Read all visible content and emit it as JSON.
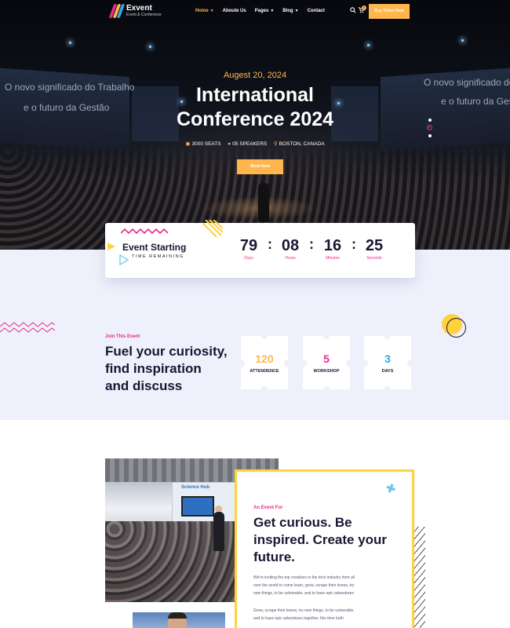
{
  "brand": {
    "name": "Exvent",
    "tagline": "Event & Conference"
  },
  "nav": {
    "items": [
      {
        "label": "Home",
        "dropdown": true,
        "active": true
      },
      {
        "label": "Aboute Us",
        "dropdown": false,
        "active": false
      },
      {
        "label": "Pages",
        "dropdown": true,
        "active": false
      },
      {
        "label": "Blog",
        "dropdown": true,
        "active": false
      },
      {
        "label": "Contact",
        "dropdown": false,
        "active": false
      }
    ],
    "cart_count": "0",
    "buy_button": "Buy Ticket Now"
  },
  "hero": {
    "bg_text_left_1": "O novo significado do Trabalho",
    "bg_text_left_2": "e o futuro da Gestão",
    "bg_text_right_1": "O novo significado do Trabalho",
    "bg_text_right_2": "e o futuro da Gestão",
    "date": "Augest 20, 2024",
    "title_line1": "International",
    "title_line2": "Conference 2024",
    "seats": "3000 SEATS",
    "speakers": "05 SPEAKERS",
    "location": "BOSTON, CANADA",
    "cta": "Book Now",
    "slides": 3,
    "active_slide": 2
  },
  "countdown": {
    "title": "Event Starting",
    "subtitle": "TIME REMAINING",
    "units": [
      {
        "value": "79",
        "label": "Days"
      },
      {
        "value": "08",
        "label": "Hours"
      },
      {
        "value": "16",
        "label": "Minutes"
      },
      {
        "value": "25",
        "label": "Seconds"
      }
    ]
  },
  "join": {
    "eyebrow": "Join This Event",
    "heading_line1": "Fuel your curiosity,",
    "heading_line2": "find inspiration",
    "heading_line3": "and discuss",
    "stats": [
      {
        "value": "120",
        "label": "ATTENDENCE",
        "color": "#ffb74d"
      },
      {
        "value": "5",
        "label": "WORKSHOP",
        "color": "#ec2a8a"
      },
      {
        "value": "3",
        "label": "DAYS",
        "color": "#29a8e8"
      }
    ]
  },
  "about": {
    "photo_sign": "Science Hub",
    "eyebrow": "An Event For",
    "heading_line1": "Get curious. Be",
    "heading_line2": "inspired. Create your",
    "heading_line3": "future.",
    "para1_line1": "We're inviting the top creatives in the tech industry from all",
    "para1_line2": "over the world to come learn, grow, scrape their knees, try",
    "para1_line3": "new things, to be vulnerable, and to have epic adventures",
    "para2_line1": "Grow, scrape their knees, try new things, to be vulnerable,",
    "para2_line2": "and to have epic adventures together, this time both"
  },
  "colors": {
    "accent": "#ffb74d",
    "pink": "#ec2a8a",
    "blue": "#29a8e8",
    "navy": "#1a1633",
    "lavender": "#eef0fb",
    "yellow": "#ffd23f"
  }
}
